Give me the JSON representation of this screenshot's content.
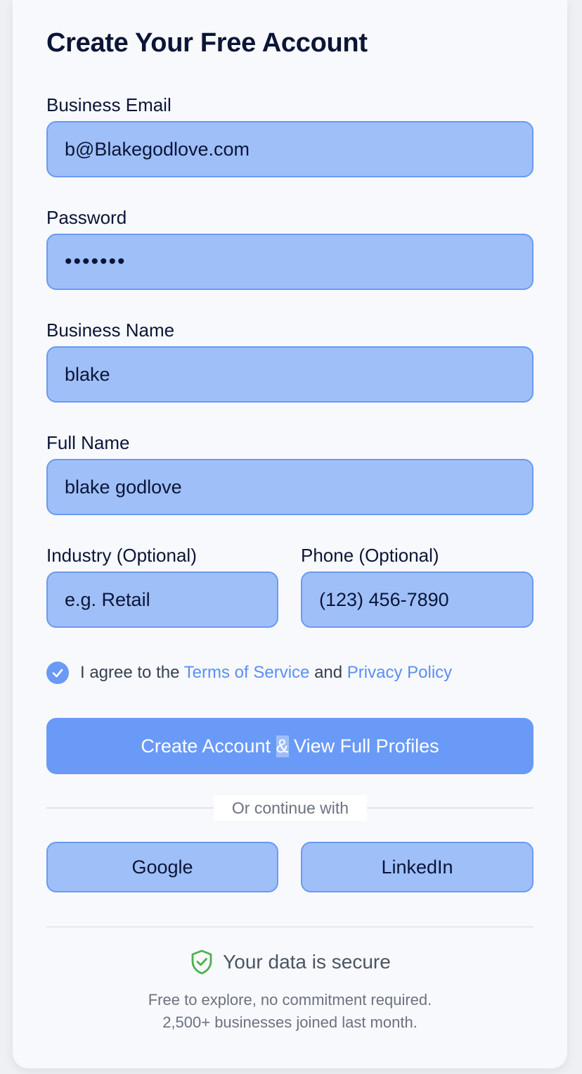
{
  "form": {
    "title": "Create Your Free Account",
    "email": {
      "label": "Business Email",
      "value": "b@Blakegodlove.com"
    },
    "password": {
      "label": "Password",
      "value": "•••••••"
    },
    "business_name": {
      "label": "Business Name",
      "value": "blake"
    },
    "full_name": {
      "label": "Full Name",
      "value": "blake godlove"
    },
    "industry": {
      "label": "Industry (Optional)",
      "placeholder": "e.g. Retail"
    },
    "phone": {
      "label": "Phone (Optional)",
      "placeholder": "(123) 456-7890"
    }
  },
  "agreement": {
    "checked": true,
    "prefix": "I agree to the",
    "terms_link": "Terms of Service",
    "and": "and",
    "privacy_link": "Privacy Policy"
  },
  "submit": {
    "part1": "Create Account",
    "amp": "&",
    "part2": "View Full Profiles"
  },
  "divider": {
    "text": "Or continue with"
  },
  "social": {
    "google": "Google",
    "linkedin": "LinkedIn"
  },
  "footer": {
    "secure_text": "Your data is secure",
    "line1": "Free to explore, no commitment required.",
    "line2": "2,500+ businesses joined last month."
  },
  "colors": {
    "accent": "#6a9af7",
    "field_bg": "#9fbff9",
    "link": "#5b8ef5",
    "shield": "#4caf50"
  },
  "icons": {
    "checkbox": "check-icon",
    "secure": "shield-check-icon"
  }
}
